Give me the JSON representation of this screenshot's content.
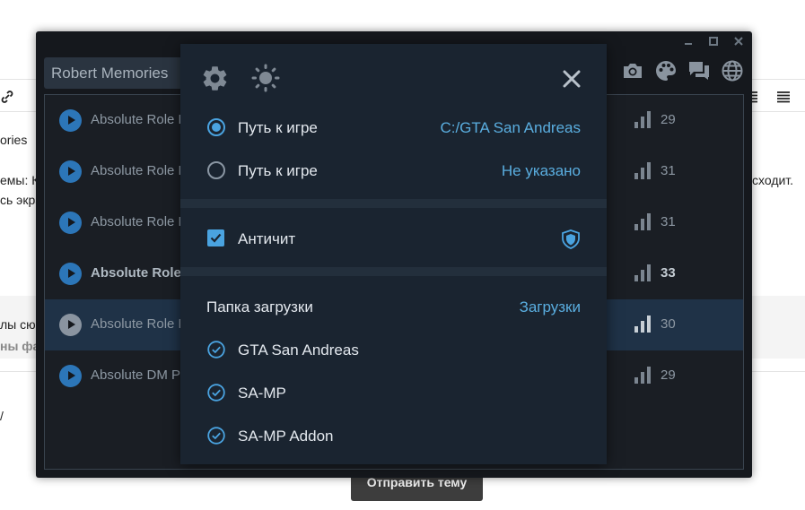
{
  "background_page": {
    "toolbar_left_icon": "link-icon",
    "fragment_1": "ories",
    "fragment_2": "емы: К",
    "fragment_3": "сь экра",
    "fragment_4": "сходит.",
    "fragment_5": "лы сю",
    "fragment_6": "ны фай",
    "fragment_7": "/",
    "submit_button": "Отправить тему"
  },
  "launcher": {
    "search_value": "Robert Memories",
    "window_controls": [
      "minimize-icon",
      "maximize-icon",
      "close-icon"
    ],
    "toolbar_icons": [
      "camera-icon",
      "palette-icon",
      "chat-icon",
      "globe-icon"
    ],
    "servers": [
      {
        "name": "Absolute Role P",
        "players": "29",
        "active": false,
        "bold": false
      },
      {
        "name": "Absolute Role P",
        "players": "31",
        "active": false,
        "bold": false
      },
      {
        "name": "Absolute Role P",
        "players": "31",
        "active": false,
        "bold": false
      },
      {
        "name": "Absolute Role P",
        "players": "33",
        "active": false,
        "bold": true
      },
      {
        "name": "Absolute Role P",
        "players": "30",
        "active": true,
        "bold": false
      },
      {
        "name": "Absolute DM P",
        "players": "29",
        "active": false,
        "bold": false
      }
    ]
  },
  "settings": {
    "header_icons": [
      "gear-icon",
      "sun-icon",
      "close-icon"
    ],
    "game_path_1": {
      "label": "Путь к игре",
      "value": "C:/GTA San Andreas",
      "selected": true
    },
    "game_path_2": {
      "label": "Путь к игре",
      "value": "Не указано",
      "selected": false
    },
    "anticheat": {
      "label": "Античит",
      "checked": true,
      "icon": "shield-icon"
    },
    "downloads": {
      "label": "Папка загрузки",
      "value": "Загрузки"
    },
    "components": [
      {
        "label": "GTA San Andreas",
        "checked": true
      },
      {
        "label": "SA-MP",
        "checked": true
      },
      {
        "label": "SA-MP Addon",
        "checked": true
      }
    ],
    "colors": {
      "accent": "#4aa3e0",
      "panel": "#1a2430",
      "window": "#15181d"
    }
  }
}
